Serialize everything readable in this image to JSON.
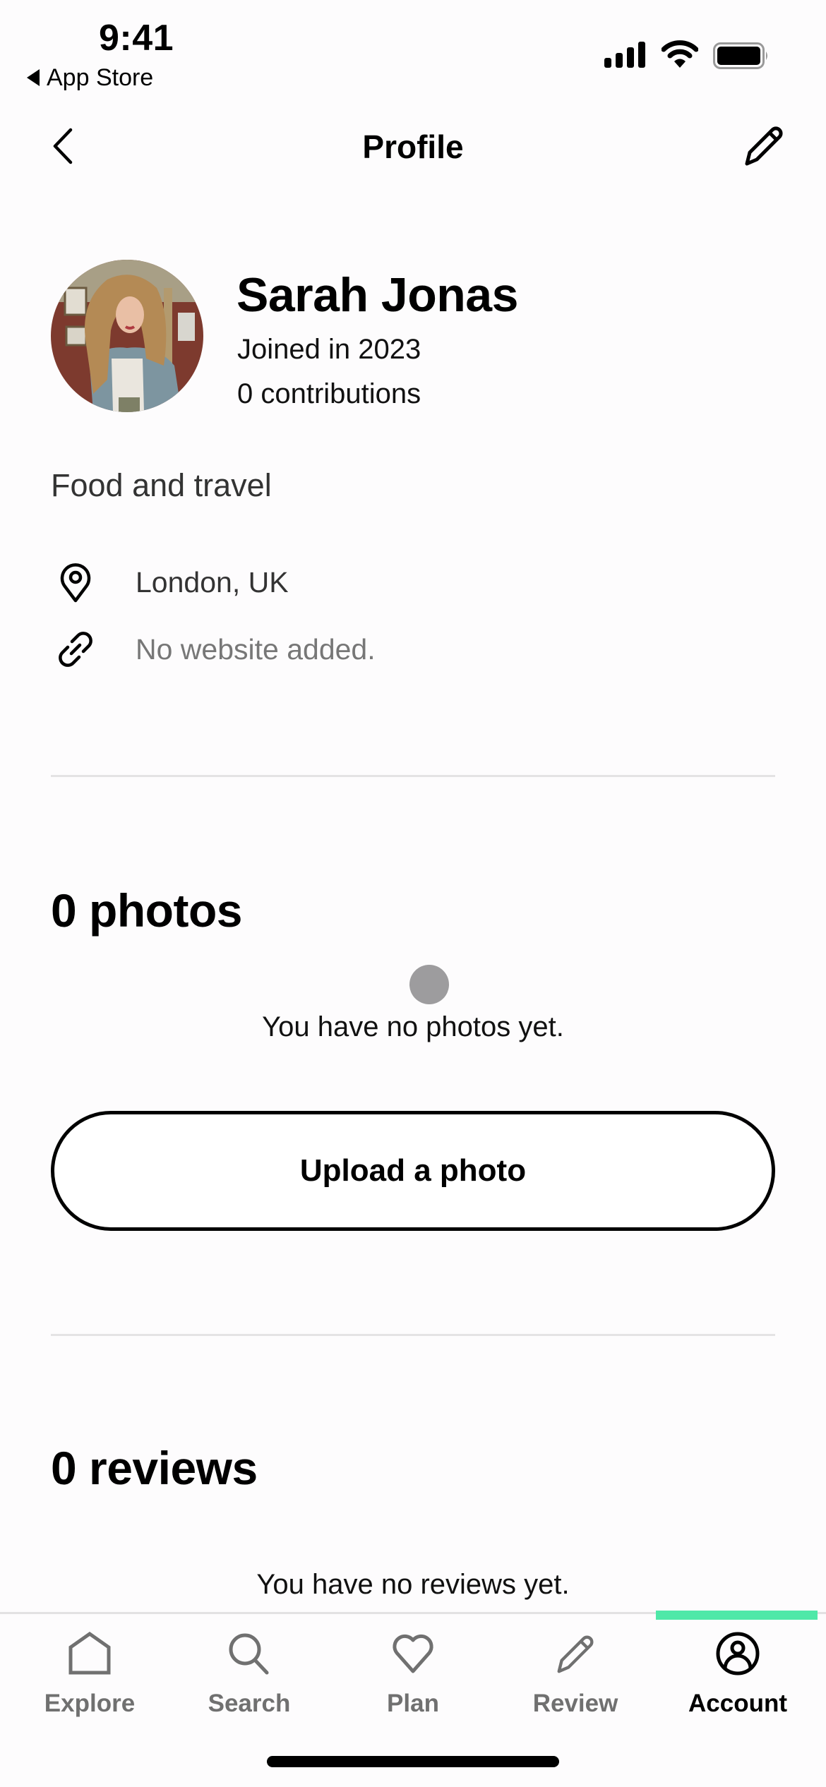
{
  "status_bar": {
    "time": "9:41",
    "back_app": "App Store",
    "icons": [
      "signal-icon",
      "wifi-icon",
      "battery-icon"
    ]
  },
  "header": {
    "title": "Profile",
    "back_icon": "chevron-left-icon",
    "edit_icon": "pencil-icon"
  },
  "profile": {
    "name": "Sarah Jonas",
    "joined": "Joined in 2023",
    "contributions": "0 contributions",
    "bio": "Food and travel",
    "location": "London, UK",
    "website": "No website added."
  },
  "photos": {
    "title": "0 photos",
    "empty_message": "You have no photos yet.",
    "upload_label": "Upload a photo"
  },
  "reviews": {
    "title": "0 reviews",
    "empty_message": "You have no reviews yet."
  },
  "tabbar": {
    "accent": "#4fe8a8",
    "active": "Account",
    "items": [
      {
        "label": "Explore",
        "icon": "home-icon"
      },
      {
        "label": "Search",
        "icon": "search-icon"
      },
      {
        "label": "Plan",
        "icon": "heart-icon"
      },
      {
        "label": "Review",
        "icon": "pencil-icon"
      },
      {
        "label": "Account",
        "icon": "user-circle-icon"
      }
    ]
  }
}
